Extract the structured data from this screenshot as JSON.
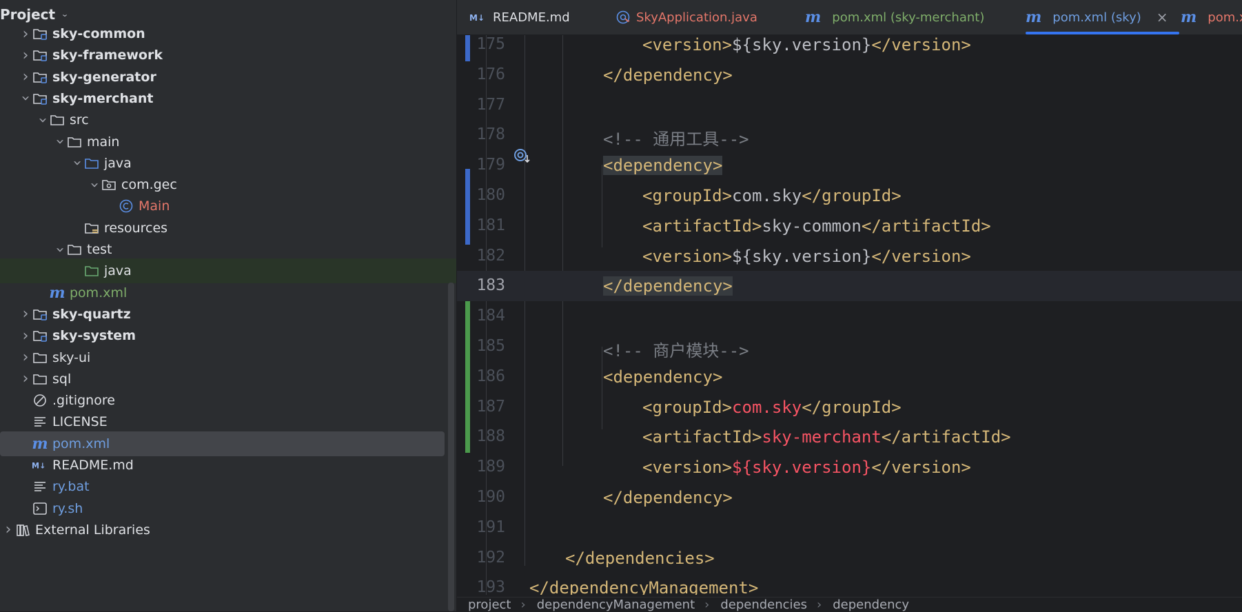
{
  "project_panel": {
    "title": "Project",
    "tree": [
      {
        "label": "sky-common",
        "style": "bold",
        "icon": "module-folder-icon",
        "arrow": "collapsed",
        "indent": 0
      },
      {
        "label": "sky-framework",
        "style": "bold",
        "icon": "module-folder-icon",
        "arrow": "collapsed",
        "indent": 0
      },
      {
        "label": "sky-generator",
        "style": "bold",
        "icon": "module-folder-icon",
        "arrow": "collapsed",
        "indent": 0
      },
      {
        "label": "sky-merchant",
        "style": "bold",
        "icon": "module-folder-icon",
        "arrow": "expanded",
        "indent": 0
      },
      {
        "label": "src",
        "style": "white",
        "icon": "folder-icon",
        "arrow": "expanded",
        "indent": 1
      },
      {
        "label": "main",
        "style": "white",
        "icon": "folder-icon",
        "arrow": "expanded",
        "indent": 2
      },
      {
        "label": "java",
        "style": "white",
        "icon": "source-folder-icon",
        "arrow": "expanded",
        "indent": 3
      },
      {
        "label": "com.gec",
        "style": "white",
        "icon": "package-icon",
        "arrow": "expanded",
        "indent": 4
      },
      {
        "label": "Main",
        "style": "orange",
        "icon": "java-class-icon",
        "arrow": "none",
        "indent": 5
      },
      {
        "label": "resources",
        "style": "white",
        "icon": "resources-folder-icon",
        "arrow": "none",
        "indent": 3
      },
      {
        "label": "test",
        "style": "white",
        "icon": "folder-icon",
        "arrow": "expanded",
        "indent": 2
      },
      {
        "label": "java",
        "style": "white",
        "icon": "test-folder-icon",
        "arrow": "none",
        "indent": 3,
        "bg": "green"
      },
      {
        "label": "pom.xml",
        "style": "green",
        "icon": "maven-icon",
        "arrow": "none",
        "indent": 1
      },
      {
        "label": "sky-quartz",
        "style": "bold",
        "icon": "module-folder-icon",
        "arrow": "collapsed",
        "indent": 0
      },
      {
        "label": "sky-system",
        "style": "bold",
        "icon": "module-folder-icon",
        "arrow": "collapsed",
        "indent": 0
      },
      {
        "label": "sky-ui",
        "style": "white",
        "icon": "folder-icon",
        "arrow": "collapsed",
        "indent": 0
      },
      {
        "label": "sql",
        "style": "white",
        "icon": "folder-icon",
        "arrow": "collapsed",
        "indent": 0
      },
      {
        "label": ".gitignore",
        "style": "white",
        "icon": "ignore-icon",
        "arrow": "none",
        "indent": 0
      },
      {
        "label": "LICENSE",
        "style": "white",
        "icon": "text-file-icon",
        "arrow": "none",
        "indent": 0
      },
      {
        "label": "pom.xml",
        "style": "blue",
        "icon": "maven-icon",
        "arrow": "none",
        "indent": 0,
        "bg": "selected"
      },
      {
        "label": "README.md",
        "style": "white",
        "icon": "markdown-icon",
        "arrow": "none",
        "indent": 0
      },
      {
        "label": "ry.bat",
        "style": "blue",
        "icon": "text-file-icon",
        "arrow": "none",
        "indent": 0
      },
      {
        "label": "ry.sh",
        "style": "blue",
        "icon": "shell-icon",
        "arrow": "none",
        "indent": 0
      },
      {
        "label": "External Libraries",
        "style": "white",
        "icon": "libraries-icon",
        "arrow": "collapsed",
        "indent": -1
      }
    ]
  },
  "tabs": [
    {
      "label": "README.md",
      "icon": "markdown-icon",
      "color": "#dfe1e5"
    },
    {
      "label": "SkyApplication.java",
      "icon": "spring-boot-icon",
      "color": "#e5776a"
    },
    {
      "label": "pom.xml (sky-merchant)",
      "icon": "maven-icon",
      "color": "#7fae6a"
    },
    {
      "label": "pom.xml (sky)",
      "icon": "maven-icon",
      "color": "#6f9ee0",
      "active": true,
      "closable": true
    },
    {
      "label": "pom.x",
      "icon": "maven-icon",
      "color": "#e5776a"
    }
  ],
  "close_glyph": "×",
  "editor": {
    "lines": [
      {
        "n": "175",
        "indent": 3,
        "segs": [
          [
            "tag",
            "<version>"
          ],
          [
            "txt",
            "${sky.version}"
          ],
          [
            "tag",
            "</version>"
          ]
        ]
      },
      {
        "n": "176",
        "indent": 2,
        "segs": [
          [
            "tag",
            "</dependency>"
          ]
        ]
      },
      {
        "n": "177",
        "indent": 0,
        "segs": []
      },
      {
        "n": "178",
        "indent": 2,
        "segs": [
          [
            "cmt",
            "<!-- 通用工具-->"
          ]
        ]
      },
      {
        "n": "179",
        "indent": 2,
        "segs": [
          [
            "tag hl",
            "<dependency>"
          ]
        ]
      },
      {
        "n": "180",
        "indent": 3,
        "segs": [
          [
            "tag",
            "<groupId>"
          ],
          [
            "txt",
            "com.sky"
          ],
          [
            "tag",
            "</groupId>"
          ]
        ]
      },
      {
        "n": "181",
        "indent": 3,
        "segs": [
          [
            "tag",
            "<artifactId>"
          ],
          [
            "txt",
            "sky-common"
          ],
          [
            "tag",
            "</artifactId>"
          ]
        ]
      },
      {
        "n": "182",
        "indent": 3,
        "segs": [
          [
            "tag",
            "<version>"
          ],
          [
            "txt",
            "${sky.version}"
          ],
          [
            "tag",
            "</version>"
          ]
        ]
      },
      {
        "n": "183",
        "indent": 2,
        "segs": [
          [
            "tag hl",
            "</dependency>"
          ]
        ],
        "current": true
      },
      {
        "n": "184",
        "indent": 0,
        "segs": []
      },
      {
        "n": "185",
        "indent": 2,
        "segs": [
          [
            "cmt",
            "<!-- 商户模块-->"
          ]
        ]
      },
      {
        "n": "186",
        "indent": 2,
        "segs": [
          [
            "tag",
            "<dependency>"
          ]
        ]
      },
      {
        "n": "187",
        "indent": 3,
        "segs": [
          [
            "tag",
            "<groupId>"
          ],
          [
            "red",
            "com.sky"
          ],
          [
            "tag",
            "</groupId>"
          ]
        ]
      },
      {
        "n": "188",
        "indent": 3,
        "segs": [
          [
            "tag",
            "<artifactId>"
          ],
          [
            "red",
            "sky-merchant"
          ],
          [
            "tag",
            "</artifactId>"
          ]
        ]
      },
      {
        "n": "189",
        "indent": 3,
        "segs": [
          [
            "tag",
            "<version>"
          ],
          [
            "red",
            "${sky.version}"
          ],
          [
            "tag",
            "</version>"
          ]
        ]
      },
      {
        "n": "190",
        "indent": 2,
        "segs": [
          [
            "tag",
            "</dependency>"
          ]
        ]
      },
      {
        "n": "191",
        "indent": 0,
        "segs": []
      },
      {
        "n": "192",
        "indent": 1,
        "segs": [
          [
            "tag",
            "</dependencies>"
          ]
        ]
      },
      {
        "n": "193",
        "indent": 0,
        "segs": [
          [
            "tag",
            "</dependencyManagement>"
          ]
        ]
      }
    ]
  },
  "breadcrumb": [
    "project",
    "dependencyManagement",
    "dependencies",
    "dependency"
  ],
  "colors": {
    "accent": "#3574f0",
    "tag": "#d5b778",
    "error": "#f75464",
    "vcs_modified": "#3c69c9",
    "vcs_added": "#4b9a4c"
  }
}
